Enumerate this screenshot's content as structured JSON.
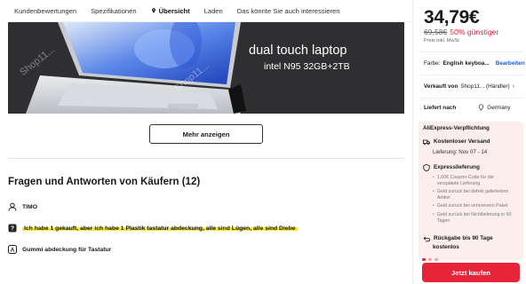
{
  "tabs": [
    {
      "label": "Kundenbewertungen"
    },
    {
      "label": "Spezifikationen"
    },
    {
      "label": "Übersicht",
      "active": true
    },
    {
      "label": "Laden"
    },
    {
      "label": "Das könnte Sie auch interessieren"
    }
  ],
  "banner": {
    "line1": "dual touch laptop",
    "line2": "intel N95  32GB+2TB",
    "watermark": "Shop11...",
    "watermark2": "Shop11..."
  },
  "more_button": "Mehr anzeigen",
  "qa": {
    "title": "Fragen und Antworten von Käufern (12)",
    "user": "TIMO",
    "question": "Ich habe 1 gekauft, aber ich habe 1 Plastik tastatur abdeckung, alle sind Lügen, alle sind Diebe",
    "answer_title": "Gummi abdeckung für Tastatur"
  },
  "product": {
    "price": "34,79€",
    "old_price": "69,58€",
    "discount": "50% günstiger",
    "tax_note": "Preis inkl. MwSt",
    "color_label": "Farbe:",
    "color_value": "English keyboa...",
    "color_edit": "Bearbeiten",
    "seller_label": "Verkauft von",
    "seller_value": "Shop11... (Händler)",
    "delivery_label": "Liefert nach",
    "delivery_value": "Germany"
  },
  "promise": {
    "title": "AliExpress-Verpflichtung",
    "free_shipping": "Kostenloser Versand",
    "delivery_date": "Lieferung: Nov 07 - 14",
    "express": "Expresslieferung",
    "express_items": [
      "1,00€ Coupon-Code für die verspätete Lieferung",
      "Geld zurück bei defekt geliefertem Artikel",
      "Geld zurück bei verlorenem Paket",
      "Geld zurück bei Nichtlieferung in 60 Tagen"
    ],
    "returns_line1": "Rückgabe bis 90 Tage",
    "returns_line2": "kostenlos"
  },
  "buy_button": "Jetzt kaufen",
  "colors": {
    "accent": "#e8243b",
    "highlight": "#f3e624",
    "link": "#2060c0"
  }
}
